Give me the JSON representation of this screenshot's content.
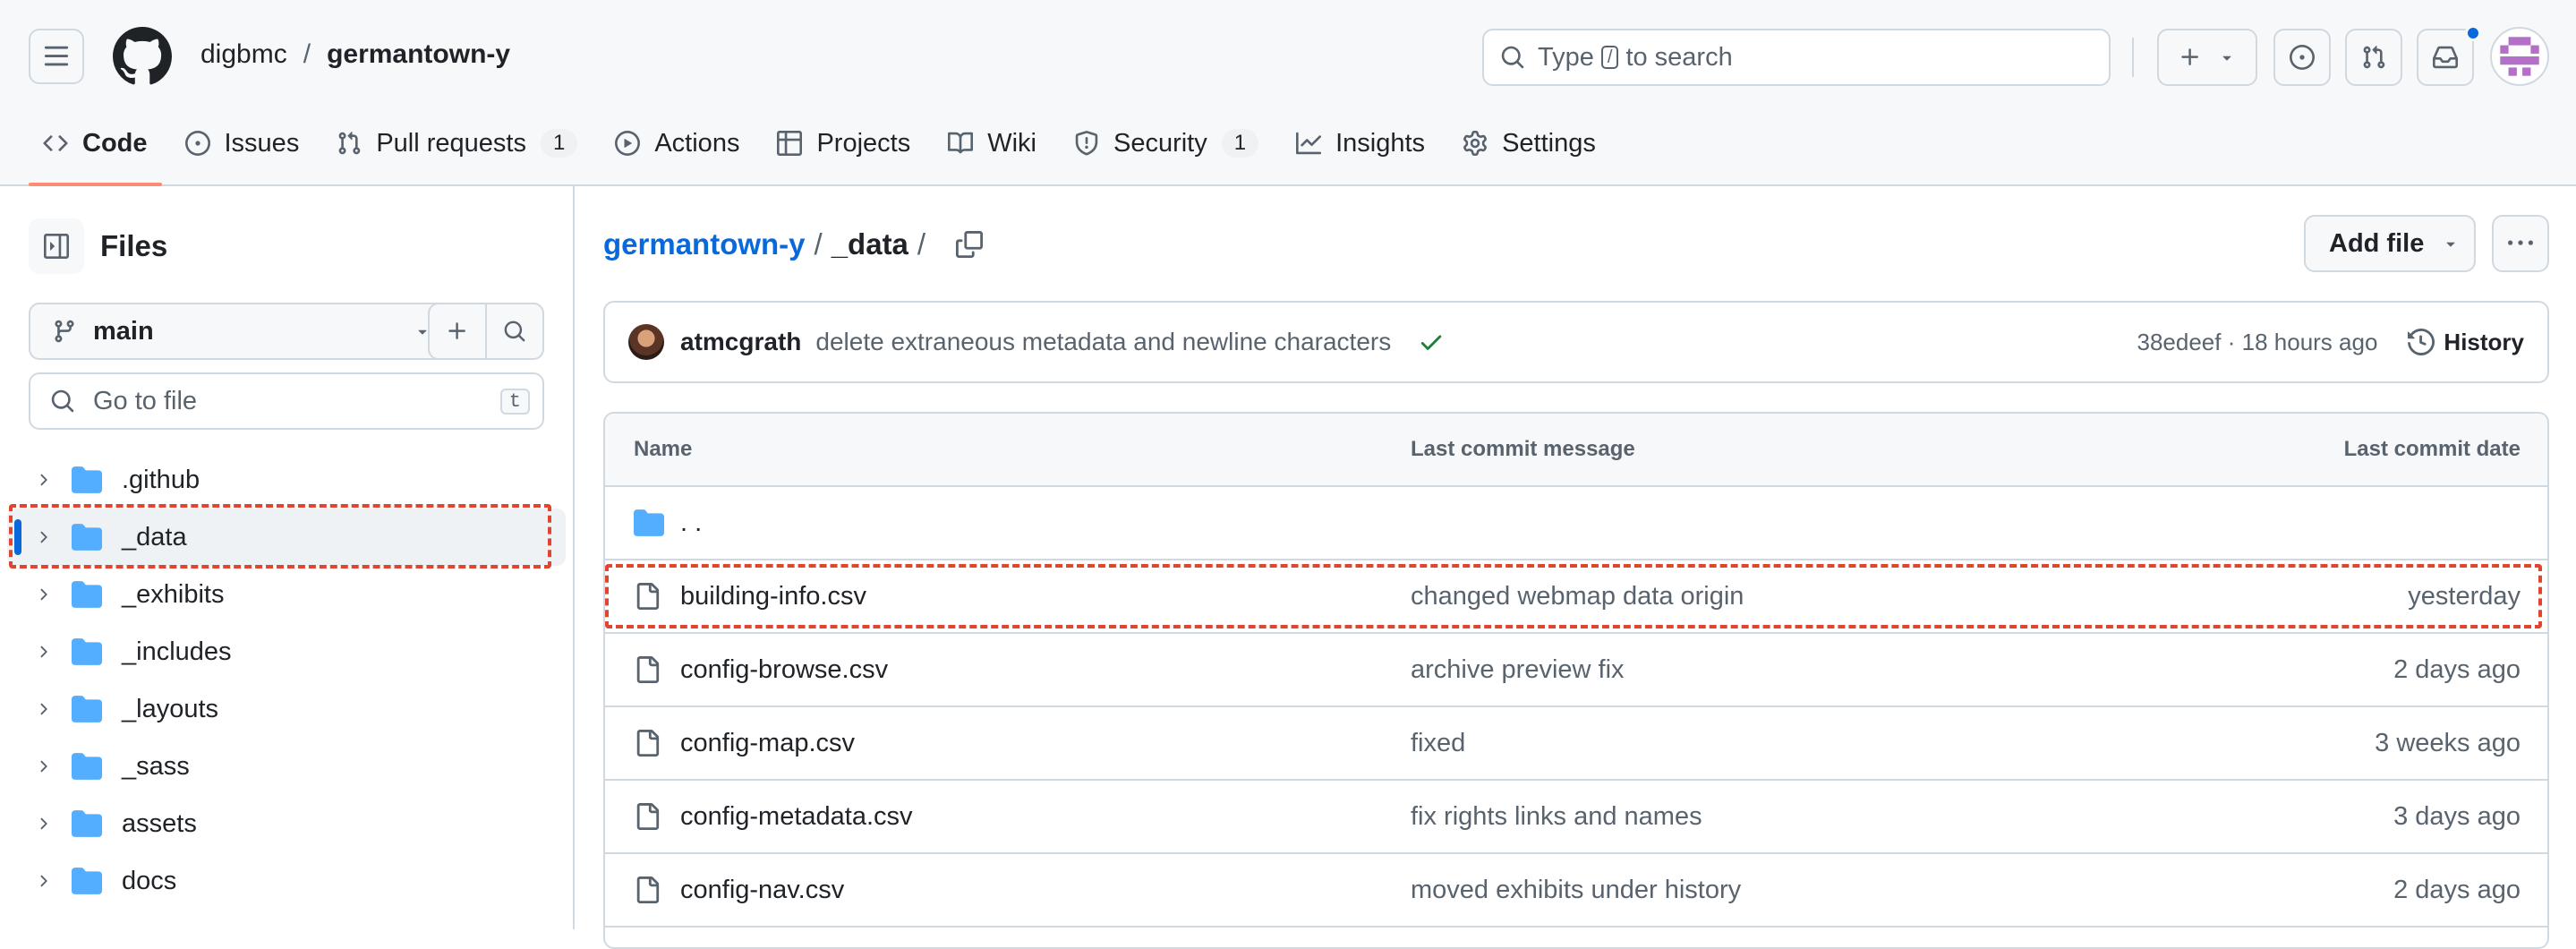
{
  "header": {
    "owner": "digbmc",
    "separator": "/",
    "repo": "germantown-y",
    "search_prefix": "Type",
    "search_key": "/",
    "search_suffix": "to search"
  },
  "tabs": [
    {
      "label": "Code",
      "icon": "code-icon",
      "selected": true
    },
    {
      "label": "Issues",
      "icon": "issue-icon"
    },
    {
      "label": "Pull requests",
      "icon": "pull-request-icon",
      "count": "1"
    },
    {
      "label": "Actions",
      "icon": "play-icon"
    },
    {
      "label": "Projects",
      "icon": "table-icon"
    },
    {
      "label": "Wiki",
      "icon": "book-icon"
    },
    {
      "label": "Security",
      "icon": "shield-icon",
      "count": "1"
    },
    {
      "label": "Insights",
      "icon": "graph-icon"
    },
    {
      "label": "Settings",
      "icon": "gear-icon"
    }
  ],
  "sidebar": {
    "title": "Files",
    "branch": "main",
    "goto_placeholder": "Go to file",
    "goto_key": "t",
    "tree": [
      {
        "label": ".github"
      },
      {
        "label": "_data",
        "selected": true
      },
      {
        "label": "_exhibits"
      },
      {
        "label": "_includes"
      },
      {
        "label": "_layouts"
      },
      {
        "label": "_sass"
      },
      {
        "label": "assets"
      },
      {
        "label": "docs"
      }
    ]
  },
  "main": {
    "crumb_repo": "germantown-y",
    "crumb_sep": "/",
    "crumb_dir": "_data",
    "crumb_trail": "/",
    "add_file_label": "Add file",
    "commit": {
      "author": "atmcgrath",
      "message": "delete extraneous metadata and newline characters",
      "sha": "38edeef",
      "dot": "·",
      "time": "18 hours ago",
      "history_label": "History"
    },
    "table": {
      "headers": {
        "name": "Name",
        "message": "Last commit message",
        "date": "Last commit date"
      },
      "parent_label": ". .",
      "rows": [
        {
          "name": "building-info.csv",
          "message": "changed webmap data origin",
          "date": "yesterday"
        },
        {
          "name": "config-browse.csv",
          "message": "archive preview fix",
          "date": "2 days ago"
        },
        {
          "name": "config-map.csv",
          "message": "fixed",
          "date": "3 weeks ago"
        },
        {
          "name": "config-metadata.csv",
          "message": "fix rights links and names",
          "date": "3 days ago"
        },
        {
          "name": "config-nav.csv",
          "message": "moved exhibits under history",
          "date": "2 days ago"
        }
      ]
    }
  },
  "colors": {
    "accent": "#0969da",
    "tab_underline": "#fd8c73",
    "folder": "#54aeff",
    "highlight_dash": "#e0452f",
    "success": "#1a7f37"
  }
}
